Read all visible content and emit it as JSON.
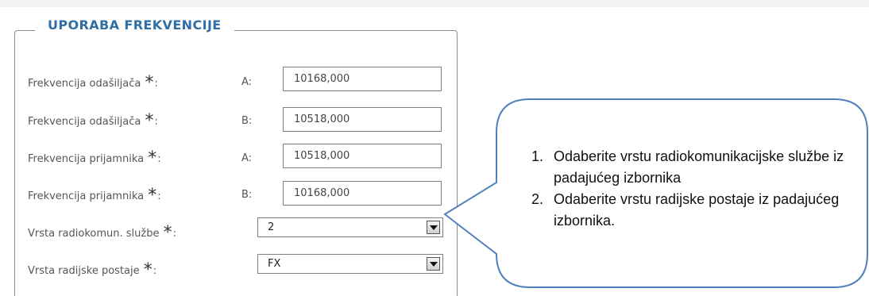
{
  "section": {
    "title": "UPORABA FREKVENCIJE",
    "required_marker": "*",
    "rows": [
      {
        "label": "Frekvencija odašiljača",
        "side": "A:",
        "value": "10168,000"
      },
      {
        "label": "Frekvencija odašiljača",
        "side": "B:",
        "value": "10518,000"
      },
      {
        "label": "Frekvencija prijamnika",
        "side": "A:",
        "value": "10518,000"
      },
      {
        "label": "Frekvencija prijamnika",
        "side": "B:",
        "value": "10168,000"
      }
    ],
    "selects": [
      {
        "label": "Vrsta radiokomun. službe",
        "value": "2"
      },
      {
        "label": "Vrsta radijske postaje",
        "value": "FX"
      }
    ]
  },
  "callout": {
    "items": [
      "Odaberite vrstu radiokomunikacijske službe iz padajućeg izbornika",
      "Odaberite vrstu radijske postaje iz padajućeg izbornika."
    ],
    "border_color": "#4f81bd"
  },
  "colors": {
    "legend": "#2f6fa5",
    "border": "#8c8c8c"
  }
}
